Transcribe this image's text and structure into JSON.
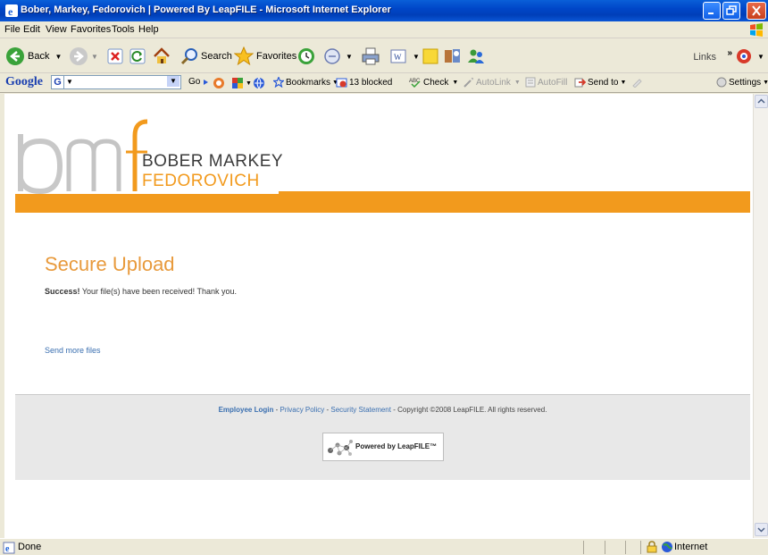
{
  "window": {
    "title": "Bober, Markey, Fedorovich | Powered By LeapFILE - Microsoft Internet Explorer"
  },
  "menubar": {
    "items": [
      "File",
      "Edit",
      "View",
      "Favorites",
      "Tools",
      "Help"
    ]
  },
  "toolbar": {
    "back_label": "Back",
    "search_label": "Search",
    "favorites_label": "Favorites",
    "links_label": "Links"
  },
  "google_toolbar": {
    "logo": "Google",
    "go_label": "Go",
    "bookmarks_label": "Bookmarks",
    "blocked_label": "13 blocked",
    "check_label": "Check",
    "autolink_label": "AutoLink",
    "autofill_label": "AutoFill",
    "sendto_label": "Send to",
    "settings_label": "Settings"
  },
  "page": {
    "logo_mark": "bmf",
    "logo_line1": "BOBER MARKEY",
    "logo_line2": "FEDOROVICH",
    "heading": "Secure Upload",
    "success_strong": "Success!",
    "success_text": " Your file(s) have been received! Thank you.",
    "send_more_link": "Send more files",
    "footer": {
      "employee_login": "Employee Login",
      "sep1": " - ",
      "privacy_policy": "Privacy Policy",
      "sep2": " - ",
      "security_statement": "Security Statement",
      "copyright": " - Copyright ©2008 LeapFILE. All rights reserved."
    },
    "powered_badge": "Powered by LeapFILE™"
  },
  "statusbar": {
    "status": "Done",
    "zone": "Internet"
  },
  "colors": {
    "accent_orange": "#f29a1d",
    "heading_orange": "#e89a3c",
    "link_blue": "#3a6fb0",
    "titlebar_blue": "#0046c8"
  }
}
